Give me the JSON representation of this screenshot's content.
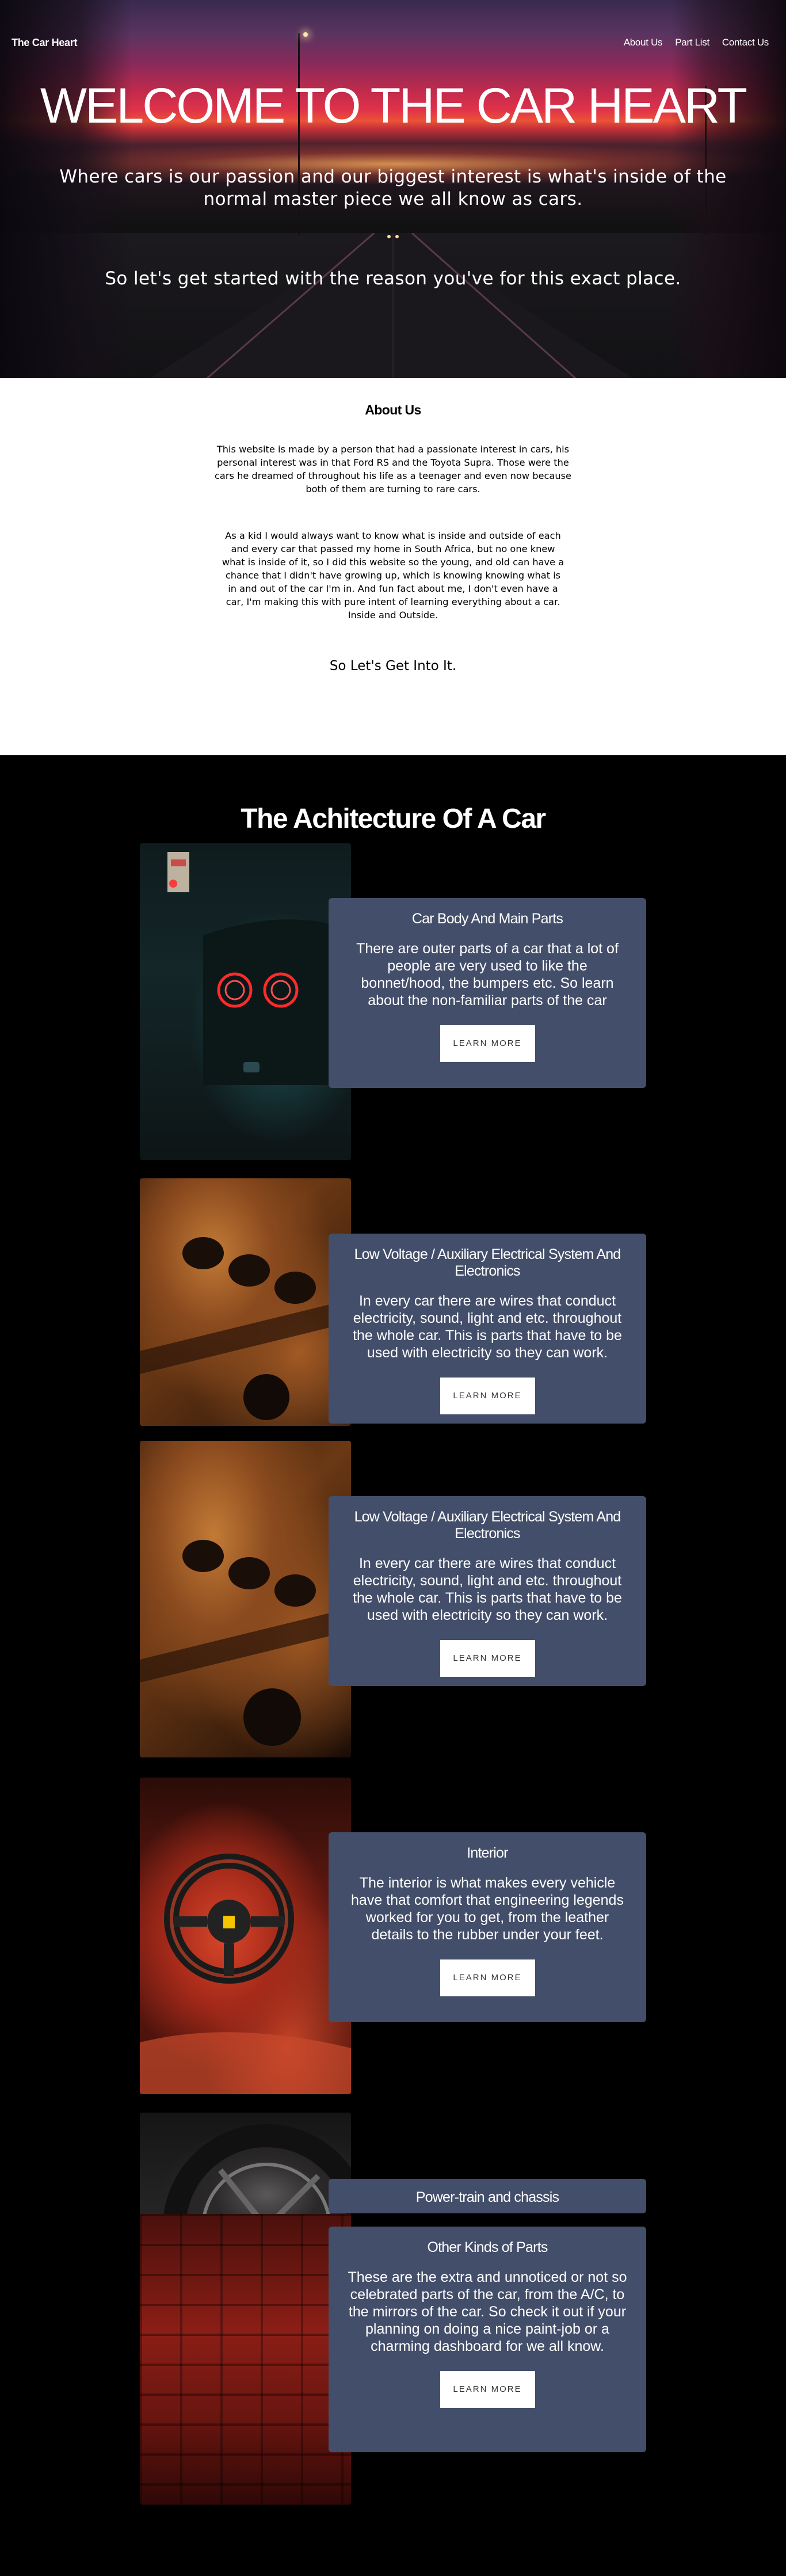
{
  "nav": {
    "brand": "The Car Heart",
    "links": [
      "About Us",
      "Part List",
      "Contact Us"
    ]
  },
  "hero": {
    "title": "WELCOME TO THE CAR HEART",
    "subtitle": "Where cars is our passion and our biggest interest is what's inside of the normal master piece we all know as cars.",
    "tagline": "So let's get started with the reason you've for this exact place."
  },
  "about": {
    "heading": "About Us",
    "paragraph1": "This website is made by a person that had a passionate interest in cars, his personal interest was in that Ford RS and the Toyota Supra. Those were the cars he dreamed of throughout his life as a teenager and even now because both of them are turning to rare cars.",
    "paragraph2": "As a kid I would always want to know what is inside and outside of each and every car that passed my home in South Africa, but no one knew what is inside of it, so I did this website so the young, and old can have a chance that I didn't have growing up, which is knowing knowing what is in and out of the car I'm in. And fun fact about me, I don't even have a car, I'm making this with pure intent of learning everything about a car. Inside and Outside.",
    "closing": "So Let's Get Into It."
  },
  "architecture": {
    "title": "The Achitecture Of A Car",
    "button_label": "LEARN MORE",
    "cards": [
      {
        "title": "Car Body And Main Parts",
        "text": "There are outer parts of a car that a lot of people are very used to like the bonnet/hood, the bumpers etc. So learn about the non-familiar parts of the car"
      },
      {
        "title": "Low Voltage / Auxiliary Electrical System And Electronics",
        "text": "In every car there are wires that conduct electricity, sound, light and etc. throughout the whole car. This is parts that have to be used with electricity so they can work."
      },
      {
        "title": "Low Voltage / Auxiliary Electrical System And Electronics",
        "text": "In every car there are wires that conduct electricity, sound, light and etc. throughout the whole car. This is parts that have to be used with electricity so they can work."
      },
      {
        "title": "Interior",
        "text": "The interior is what makes every vehicle have that comfort that engineering legends worked for you to get, from the leather details to the rubber under your feet."
      },
      {
        "title": "Power-train and chassis"
      },
      {
        "title": "Other Kinds of Parts",
        "text": "These are the extra and unnoticed or not so celebrated parts of the car, from the A/C, to the mirrors of the car. So check it out if your planning on doing a nice paint-job or a charming dashboard for we all know."
      }
    ]
  }
}
